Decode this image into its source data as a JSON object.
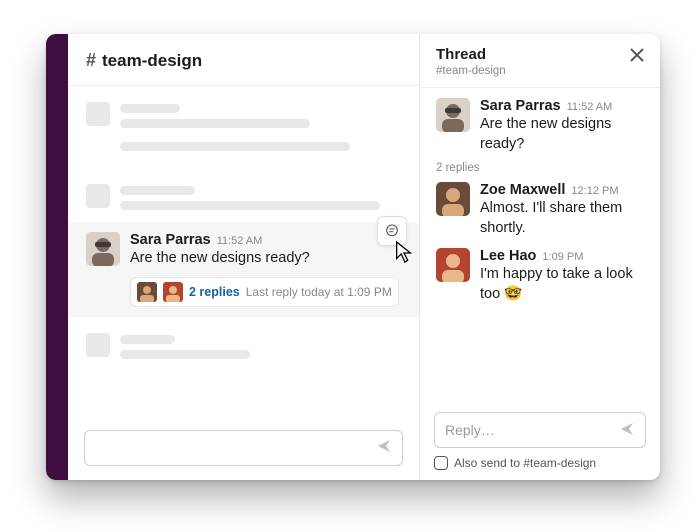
{
  "channel": {
    "prefix": "#",
    "name": "team-design"
  },
  "highlighted_message": {
    "author": "Sara Parras",
    "time": "11:52 AM",
    "text": "Are the new designs ready?",
    "reply_count_label": "2 replies",
    "last_reply_label": "Last reply today at 1:09 PM"
  },
  "thread": {
    "title": "Thread",
    "subtitle": "#team-design",
    "reply_meta": "2 replies",
    "messages": [
      {
        "author": "Sara Parras",
        "time": "11:52 AM",
        "text": "Are the new designs ready?"
      },
      {
        "author": "Zoe Maxwell",
        "time": "12:12 PM",
        "text": "Almost. I'll share them shortly."
      },
      {
        "author": "Lee Hao",
        "time": "1:09 PM",
        "text": "I'm happy to take a look too 🤓"
      }
    ],
    "reply_placeholder": "Reply…",
    "also_send_label": "Also send to #team-design"
  }
}
